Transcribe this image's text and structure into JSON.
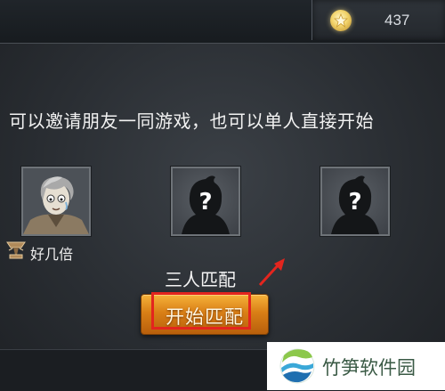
{
  "header": {
    "currency": {
      "icon": "star-coin-icon",
      "value": "437"
    }
  },
  "info_text": "可以邀请朋友一同游戏，也可以单人直接开始",
  "party": {
    "slots": [
      {
        "state": "filled",
        "player_name": "好几倍",
        "rank_icon": "trophy-rank-icon"
      },
      {
        "state": "empty",
        "icon": "question-silhouette-icon"
      },
      {
        "state": "empty",
        "icon": "question-silhouette-icon"
      }
    ]
  },
  "match": {
    "mode_label": "三人匹配",
    "start_button_label": "开始匹配"
  },
  "annotation": {
    "highlight_color": "#e3251e"
  },
  "watermark": {
    "text": "竹笋软件园"
  }
}
